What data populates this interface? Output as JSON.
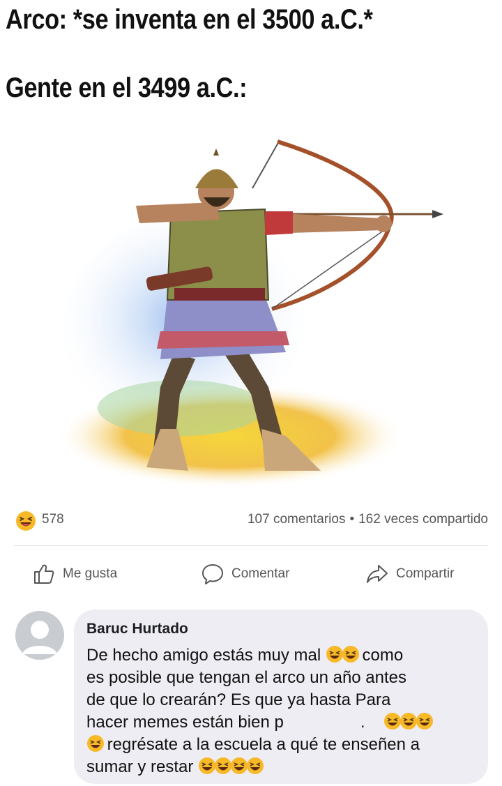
{
  "meme": {
    "caption_line1": "Arco: *se inventa en el 3500 a.C.*",
    "caption_line2": "Gente en el 3499 a.C.:"
  },
  "post": {
    "reaction_icon": "laughing-emoji-icon",
    "reaction_count": "578",
    "comments_count": "107 comentarios",
    "separator": "•",
    "shares_count": "162 veces compartido",
    "actions": {
      "like_label": "Me gusta",
      "comment_label": "Comentar",
      "share_label": "Compartir"
    },
    "colors": {
      "reaction": "#f7b928",
      "text_secondary": "#65676b",
      "bubble": "#eeedf3"
    }
  },
  "comment": {
    "author": "Baruc Hurtado",
    "line1_text": "De hecho amigo estás muy mal",
    "line1_end": "como",
    "line2": "es posible que tengan el arco  un año antes",
    "line3": "de que lo crearán? Es que ya hasta Para",
    "line4_start": "hacer memes están bien p",
    "line4_dot": ".",
    "line5": "regrésate a la escuela a qué te enseñen a",
    "line6": "sumar y restar"
  }
}
